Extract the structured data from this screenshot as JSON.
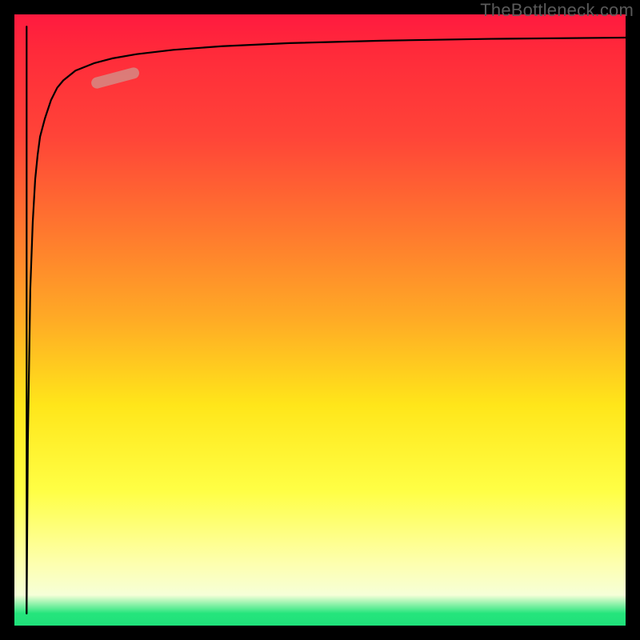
{
  "watermark": "TheBottleneck.com",
  "chart_data": {
    "type": "line",
    "title": "",
    "xlabel": "",
    "ylabel": "",
    "xlim": [
      0,
      100
    ],
    "ylim": [
      0,
      100
    ],
    "grid": false,
    "legend": false,
    "gradient_stops": [
      {
        "pct": 0,
        "color": "#ff1a3f"
      },
      {
        "pct": 20,
        "color": "#ff4438"
      },
      {
        "pct": 36,
        "color": "#ff7a2e"
      },
      {
        "pct": 50,
        "color": "#ffab25"
      },
      {
        "pct": 64,
        "color": "#ffe61a"
      },
      {
        "pct": 78,
        "color": "#ffff45"
      },
      {
        "pct": 90,
        "color": "#fdffb0"
      },
      {
        "pct": 98,
        "color": "#25e57c"
      },
      {
        "pct": 100,
        "color": "#1fe07a"
      }
    ],
    "series": [
      {
        "name": "curve",
        "color": "#000000",
        "x": [
          2.0,
          2.2,
          2.6,
          3.0,
          3.4,
          3.8,
          4.2,
          5.0,
          6.0,
          7.0,
          8.0,
          10,
          13,
          16,
          20,
          26,
          34,
          45,
          60,
          78,
          100
        ],
        "y": [
          2.0,
          30,
          55,
          66,
          73,
          77,
          80,
          83,
          86,
          88,
          89.2,
          90.8,
          92.0,
          92.8,
          93.5,
          94.2,
          94.8,
          95.3,
          95.7,
          96.0,
          96.2
        ]
      },
      {
        "name": "initial-spike",
        "color": "#000000",
        "x": [
          2.0,
          2.0
        ],
        "y": [
          98.0,
          2.0
        ]
      }
    ],
    "highlight_segment": {
      "color": "#d48c86",
      "x": [
        13.5,
        19.5
      ],
      "y": [
        88.8,
        90.4
      ]
    }
  }
}
